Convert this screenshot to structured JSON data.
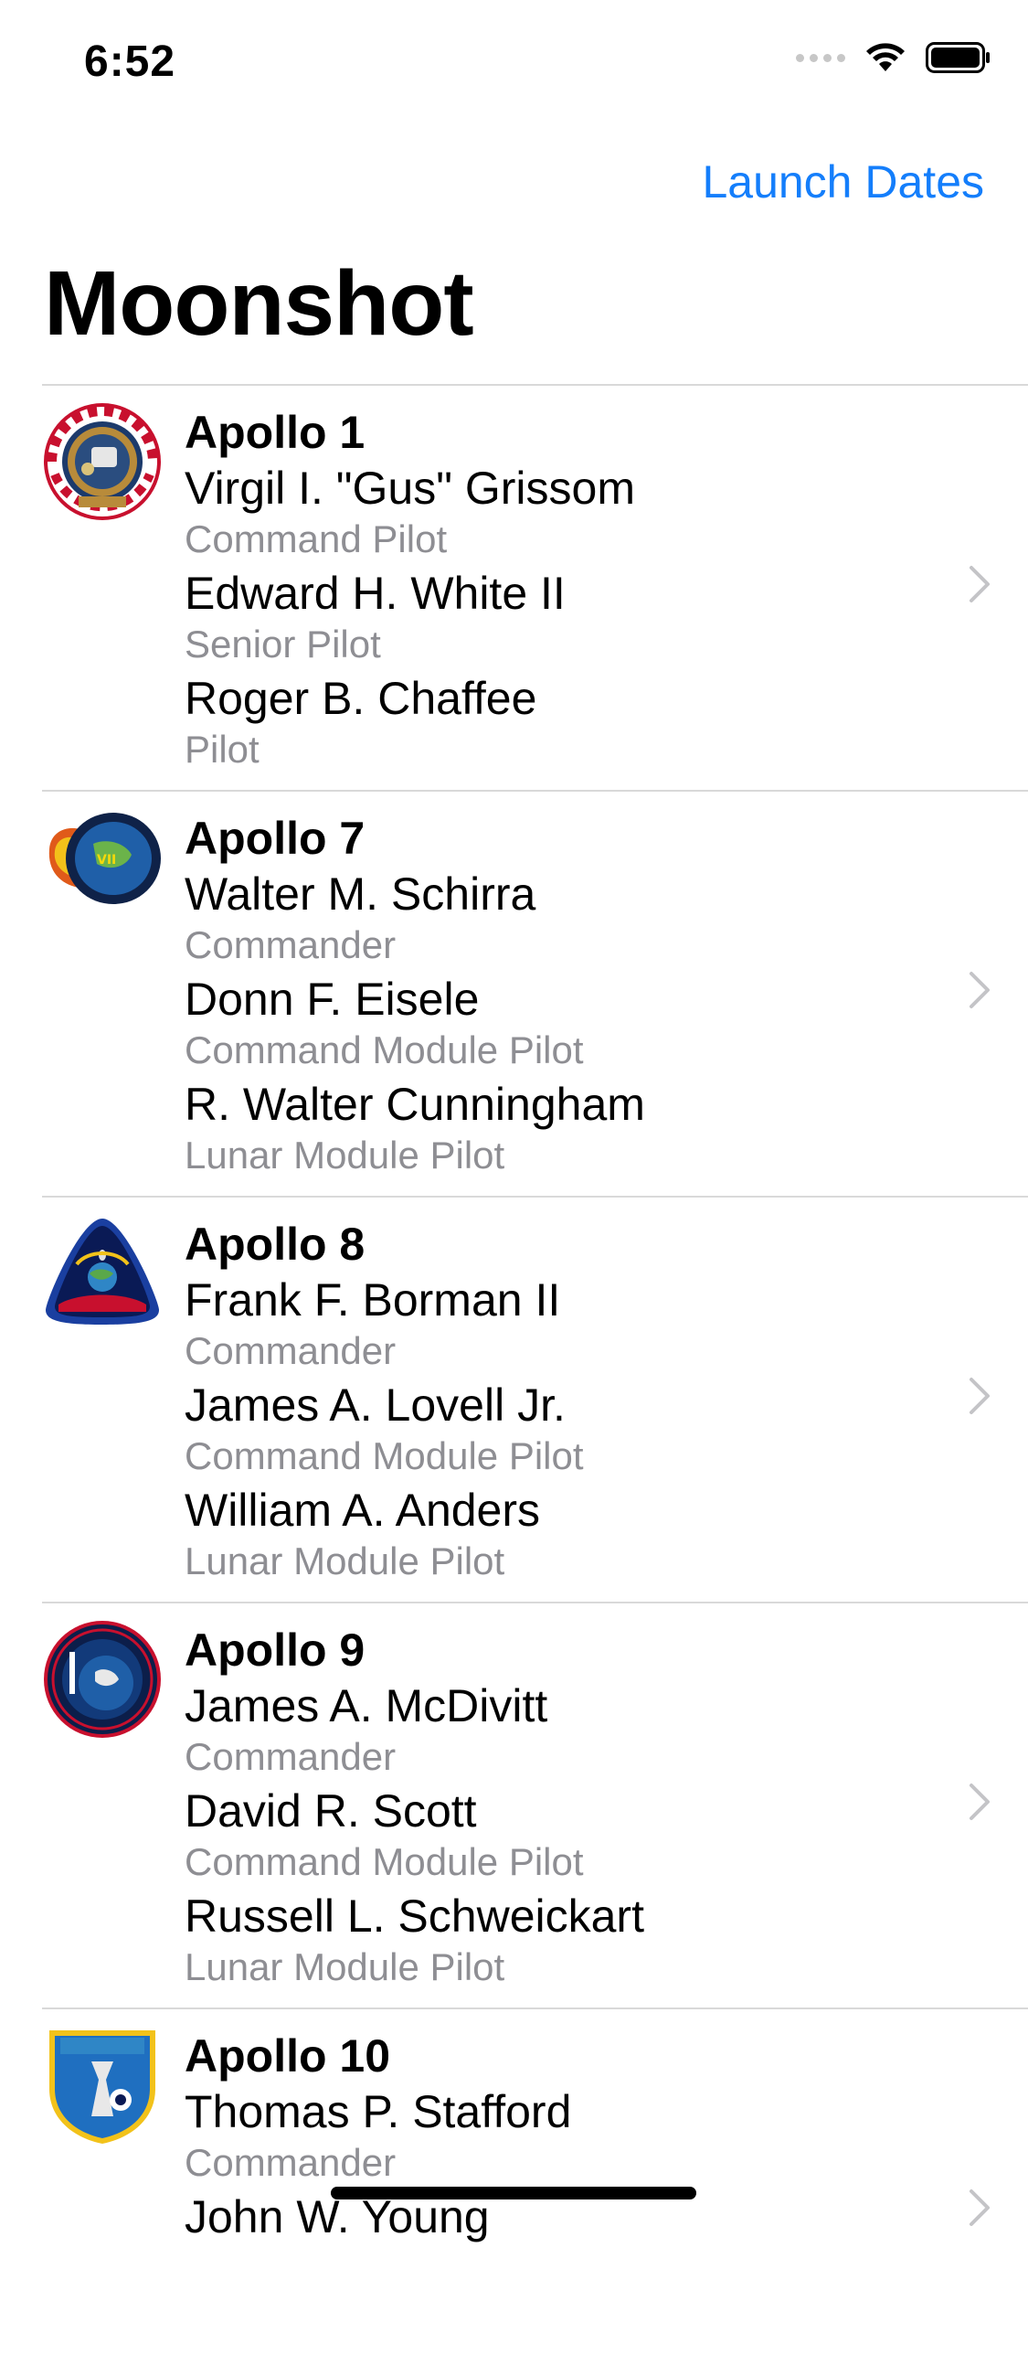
{
  "status_bar": {
    "time": "6:52",
    "icons": [
      "cellular-signal-icon",
      "wifi-icon",
      "battery-icon"
    ]
  },
  "nav": {
    "right_button": "Launch Dates",
    "title": "Moonshot",
    "accent_color": "#147efb"
  },
  "missions": [
    {
      "name": "Apollo 1",
      "badge": "apollo-1-badge-icon",
      "crew": [
        {
          "name": "Virgil I. \"Gus\" Grissom",
          "role": "Command Pilot"
        },
        {
          "name": "Edward H. White II",
          "role": "Senior Pilot"
        },
        {
          "name": "Roger B. Chaffee",
          "role": "Pilot"
        }
      ]
    },
    {
      "name": "Apollo 7",
      "badge": "apollo-7-badge-icon",
      "crew": [
        {
          "name": "Walter M. Schirra",
          "role": "Commander"
        },
        {
          "name": "Donn F. Eisele",
          "role": "Command Module Pilot"
        },
        {
          "name": "R. Walter Cunningham",
          "role": "Lunar Module Pilot"
        }
      ]
    },
    {
      "name": "Apollo 8",
      "badge": "apollo-8-badge-icon",
      "crew": [
        {
          "name": "Frank F. Borman II",
          "role": "Commander"
        },
        {
          "name": "James A. Lovell Jr.",
          "role": "Command Module Pilot"
        },
        {
          "name": "William A. Anders",
          "role": "Lunar Module Pilot"
        }
      ]
    },
    {
      "name": "Apollo 9",
      "badge": "apollo-9-badge-icon",
      "crew": [
        {
          "name": "James A. McDivitt",
          "role": "Commander"
        },
        {
          "name": "David R. Scott",
          "role": "Command Module Pilot"
        },
        {
          "name": "Russell L. Schweickart",
          "role": "Lunar Module Pilot"
        }
      ]
    },
    {
      "name": "Apollo 10",
      "badge": "apollo-10-badge-icon",
      "crew": [
        {
          "name": "Thomas P. Stafford",
          "role": "Commander"
        },
        {
          "name": "John W. Young",
          "role": ""
        }
      ]
    }
  ]
}
